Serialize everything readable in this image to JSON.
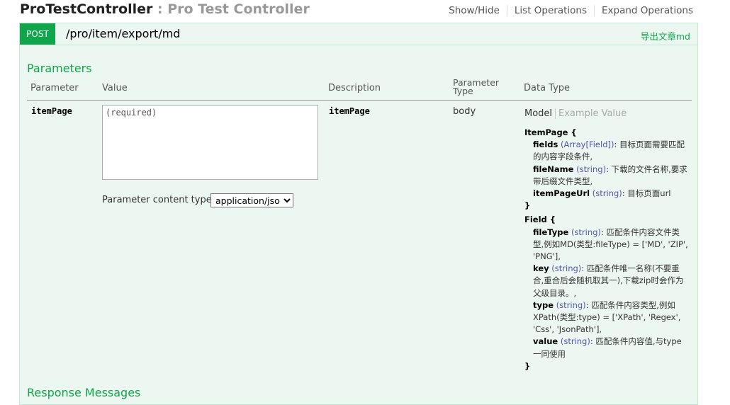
{
  "header": {
    "controller_name": "ProTestController",
    "controller_desc": ": Pro Test Controller",
    "actions": [
      "Show/Hide",
      "List Operations",
      "Expand Operations"
    ]
  },
  "operation": {
    "method": "POST",
    "path": "/pro/item/export/md",
    "summary": "导出文章md"
  },
  "parameters": {
    "title": "Parameters",
    "columns": {
      "parameter": "Parameter",
      "value": "Value",
      "description": "Description",
      "parameter_type_line1": "Parameter",
      "parameter_type_line2": "Type",
      "data_type": "Data Type"
    },
    "row": {
      "name": "itemPage",
      "value": "",
      "placeholder": "(required)",
      "description": "itemPage",
      "param_type": "body",
      "content_type_label": "Parameter content type:",
      "content_type_selected": "application/json"
    }
  },
  "model": {
    "tab_model": "Model",
    "tab_example": "Example Value",
    "item_page_open": "ItemPage {",
    "item_page_props": [
      {
        "name": "fields",
        "type": "(Array[Field])",
        "desc": ": 目标页面需要匹配的内容字段条件,"
      },
      {
        "name": "fileName",
        "type": "(string)",
        "desc": ": 下载的文件名称,要求带后缀文件类型,"
      },
      {
        "name": "itemPageUrl",
        "type": "(string)",
        "desc": ": 目标页面url"
      }
    ],
    "close_brace": "}",
    "field_open": "Field {",
    "field_props": [
      {
        "name": "fileType",
        "type": "(string)",
        "desc": ": 匹配条件内容文件类型,例如MD(类型:fileType) = ['MD', 'ZIP', 'PNG'],"
      },
      {
        "name": "key",
        "type": "(string)",
        "desc": ": 匹配条件唯一名称(不要重合,重合后会随机取其一),下载zip时会作为父级目录。,"
      },
      {
        "name": "type",
        "type": "(string)",
        "desc": ": 匹配条件内容类型,例如XPath(类型:type) = ['XPath', 'Regex', 'Css', 'JsonPath'],"
      },
      {
        "name": "value",
        "type": "(string)",
        "desc": ": 匹配条件内容值,与type一同使用"
      }
    ]
  },
  "response": {
    "title": "Response Messages"
  },
  "colors": {
    "accent_green": "#10a54a",
    "panel_bg": "#ebf7f0",
    "panel_border": "#c3e8d1",
    "type_color": "#5555aa"
  }
}
